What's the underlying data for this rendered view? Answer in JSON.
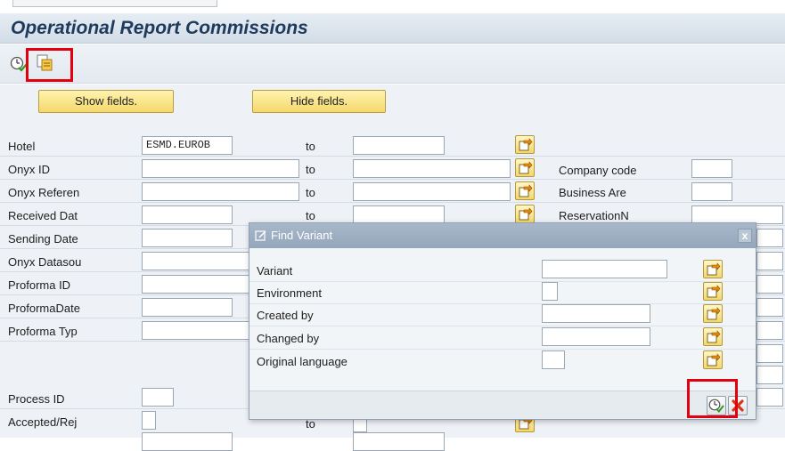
{
  "window": {
    "title": "Operational Report Commissions"
  },
  "toolbar": {
    "execute_icon": "execute-clock-icon",
    "get_variant_icon": "get-variant-icon"
  },
  "buttons": {
    "show_fields": "Show fields.",
    "hide_fields": "Hide fields."
  },
  "selection": {
    "to_label": "to",
    "rows": [
      {
        "label": "Hotel",
        "from_value": "ESMD.EUROB",
        "has_to": true
      },
      {
        "label": "Onyx ID",
        "from_value": "",
        "has_to": true
      },
      {
        "label": "Onyx Referen",
        "from_value": "",
        "has_to": true
      },
      {
        "label": "Received Dat",
        "from_value": "",
        "has_to": true
      },
      {
        "label": "Sending Date",
        "from_value": "",
        "has_to": false
      },
      {
        "label": "Onyx Datasou",
        "from_value": "",
        "has_to": false
      },
      {
        "label": "Proforma ID",
        "from_value": "",
        "has_to": false
      },
      {
        "label": "ProformaDate",
        "from_value": "",
        "has_to": false
      },
      {
        "label": "Proforma Typ",
        "from_value": "",
        "has_to": false
      },
      {
        "label": "Process ID",
        "from_value": "",
        "has_to": false
      },
      {
        "label": "Accepted/Rej",
        "from_value": "",
        "has_to": false
      }
    ],
    "right_fields": [
      {
        "label": "Company code",
        "value": ""
      },
      {
        "label": "Business Are",
        "value": ""
      },
      {
        "label": "ReservationN",
        "value": ""
      }
    ]
  },
  "dialog": {
    "title": "Find Variant",
    "close_label": "x",
    "fields": [
      {
        "label": "Variant",
        "value": ""
      },
      {
        "label": "Environment",
        "value": ""
      },
      {
        "label": "Created by",
        "value": ""
      },
      {
        "label": "Changed by",
        "value": ""
      },
      {
        "label": "Original language",
        "value": ""
      }
    ]
  },
  "colors": {
    "highlight": "#e3000f",
    "title_text": "#1e3a5c",
    "button_yellow": "#f5d86b"
  }
}
